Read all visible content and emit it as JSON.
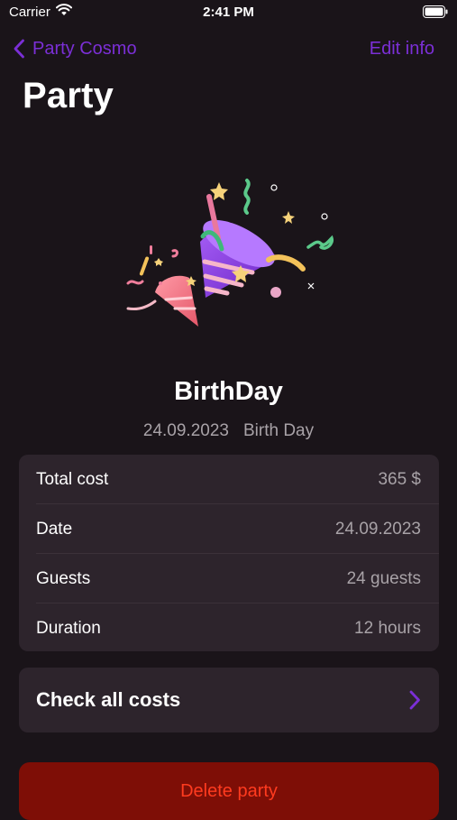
{
  "status_bar": {
    "carrier": "Carrier",
    "time": "2:41 PM"
  },
  "nav": {
    "back_label": "Party Cosmo",
    "edit_label": "Edit info"
  },
  "page_title": "Party",
  "party": {
    "name": "BirthDay",
    "date": "24.09.2023",
    "type": "Birth Day"
  },
  "details": [
    {
      "label": "Total cost",
      "value": "365 $"
    },
    {
      "label": "Date",
      "value": "24.09.2023"
    },
    {
      "label": "Guests",
      "value": "24 guests"
    },
    {
      "label": "Duration",
      "value": "12 hours"
    }
  ],
  "costs_button": {
    "label": "Check all costs"
  },
  "delete_button": {
    "label": "Delete party"
  },
  "colors": {
    "accent": "#7b2fd6",
    "background": "#1a1419",
    "card": "#2d242c",
    "danger_bg": "#7e0e06",
    "danger_text": "#ff3b1f"
  },
  "icons": {
    "hero": "party-popper-icon",
    "back": "chevron-left-icon",
    "disclosure": "chevron-right-icon"
  }
}
